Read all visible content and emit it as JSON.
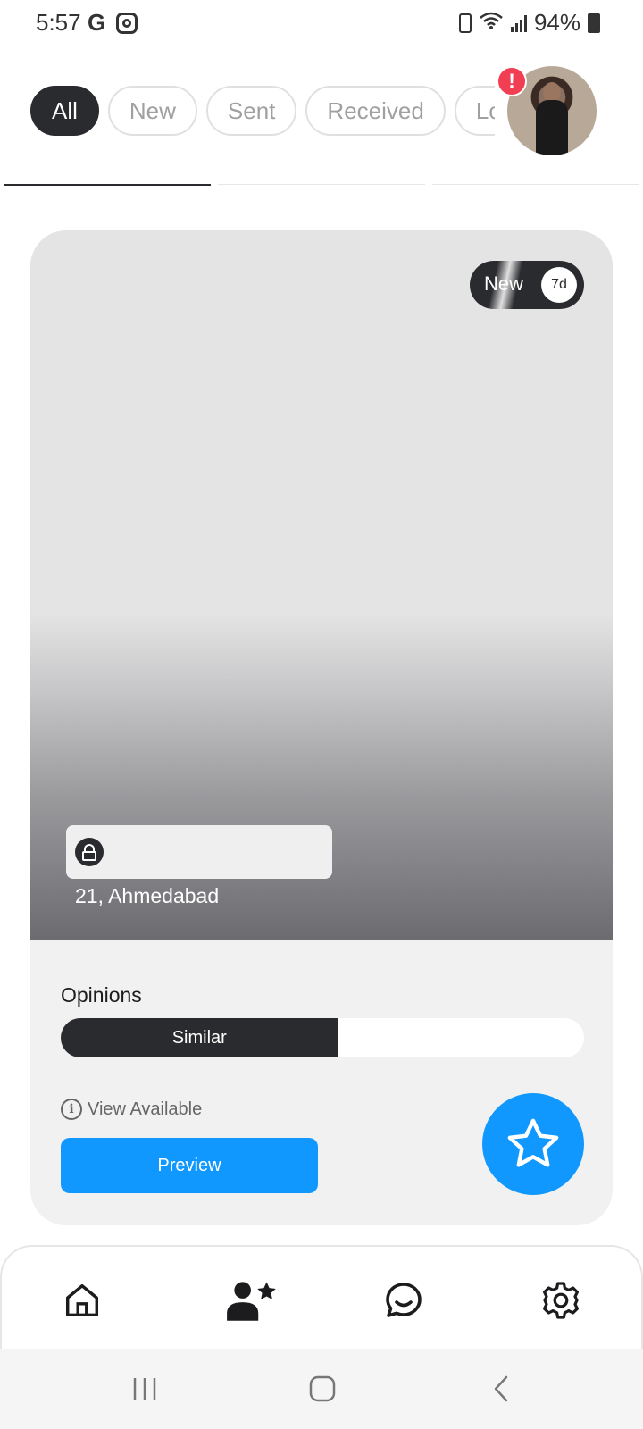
{
  "status_bar": {
    "time": "5:57",
    "app_icon_g": "G",
    "battery": "94%"
  },
  "filters": {
    "chips": [
      {
        "label": "All",
        "active": true
      },
      {
        "label": "New",
        "active": false
      },
      {
        "label": "Sent",
        "active": false
      },
      {
        "label": "Received",
        "active": false
      },
      {
        "label": "Lo",
        "active": false
      }
    ]
  },
  "alert_badge": "!",
  "card": {
    "new_badge": "New",
    "days": "7d",
    "age_location": "21, Ahmedabad",
    "opinions_label": "Opinions",
    "opinion_tag": "Similar",
    "opinion_fill_fraction": 0.53,
    "view_available": "View Available",
    "preview_button": "Preview"
  },
  "icons": {
    "home": "home-icon",
    "favorites": "person-star-icon",
    "chat": "chat-icon",
    "settings": "gear-icon"
  },
  "colors": {
    "accent_blue": "#1198ff",
    "dark": "#2a2b2e",
    "alert_red": "#f23e52"
  }
}
